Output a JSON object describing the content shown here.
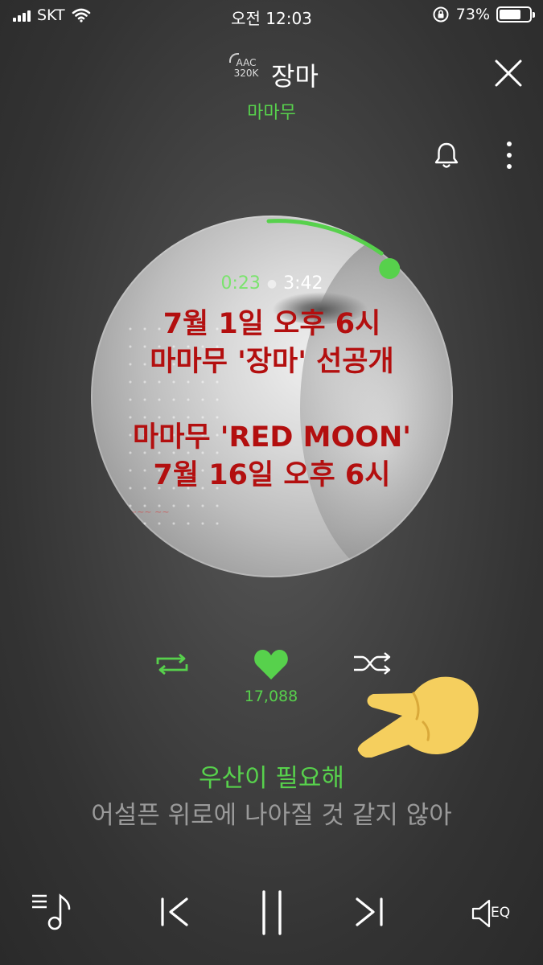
{
  "status_bar": {
    "carrier": "SKT",
    "time": "오전 12:03",
    "battery": "73%",
    "battery_level": 0.73
  },
  "header": {
    "quality_codec": "AAC",
    "quality_bitrate": "320K",
    "song_title": "장마",
    "artist": "마마무"
  },
  "player": {
    "current_time": "0:23",
    "total_time": "3:42",
    "progress": 0.104
  },
  "album_overlay": {
    "lines": [
      "7월 1일 오후 6시",
      "마마무 '장마' 선공개",
      "",
      "마마무 'RED MOON'",
      "7월 16일 오후 6시"
    ],
    "color": "#b30f0f"
  },
  "controls": {
    "like_count": "17,088"
  },
  "lyrics": {
    "current": "우산이 필요해",
    "next": "어설픈 위로에 나아질 것 같지 않아"
  },
  "bottom_bar": {
    "eq_label": "EQ"
  },
  "colors": {
    "accent": "#57d14c",
    "promo_text": "#b30f0f"
  },
  "icons": [
    "wifi-icon",
    "rotation-lock-icon",
    "close-icon",
    "bell-icon",
    "more-vertical-icon",
    "repeat-icon",
    "heart-icon",
    "shuffle-icon",
    "pointing-hand-emoji",
    "playlist-icon",
    "previous-icon",
    "pause-icon",
    "next-icon",
    "eq-speaker-icon"
  ]
}
